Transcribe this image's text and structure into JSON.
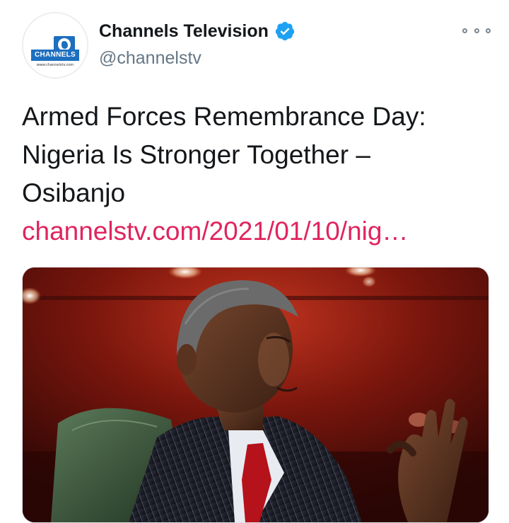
{
  "tweet": {
    "author": {
      "display_name": "Channels Television",
      "handle": "@channelstv",
      "verified": true,
      "avatar_logo_text": "CHANNELS",
      "avatar_logo_url": "www.channelstv.com"
    },
    "text_lines": [
      "Armed Forces Remembrance Day:",
      "Nigeria Is Stronger Together –",
      "Osibanjo"
    ],
    "link_text": "channelstv.com/2021/01/10/nig…",
    "more_menu_icon": "more-dots-icon",
    "verified_icon": "verified-badge-icon",
    "media": {
      "type": "photo",
      "subject": "man in pinstriped suit and red tie, gesturing, seated in green leather chair"
    }
  },
  "colors": {
    "text_primary": "#14171a",
    "text_secondary": "#657786",
    "link": "#e0245e",
    "verified": "#1da1f2",
    "brand_blue": "#1d6fbf"
  }
}
